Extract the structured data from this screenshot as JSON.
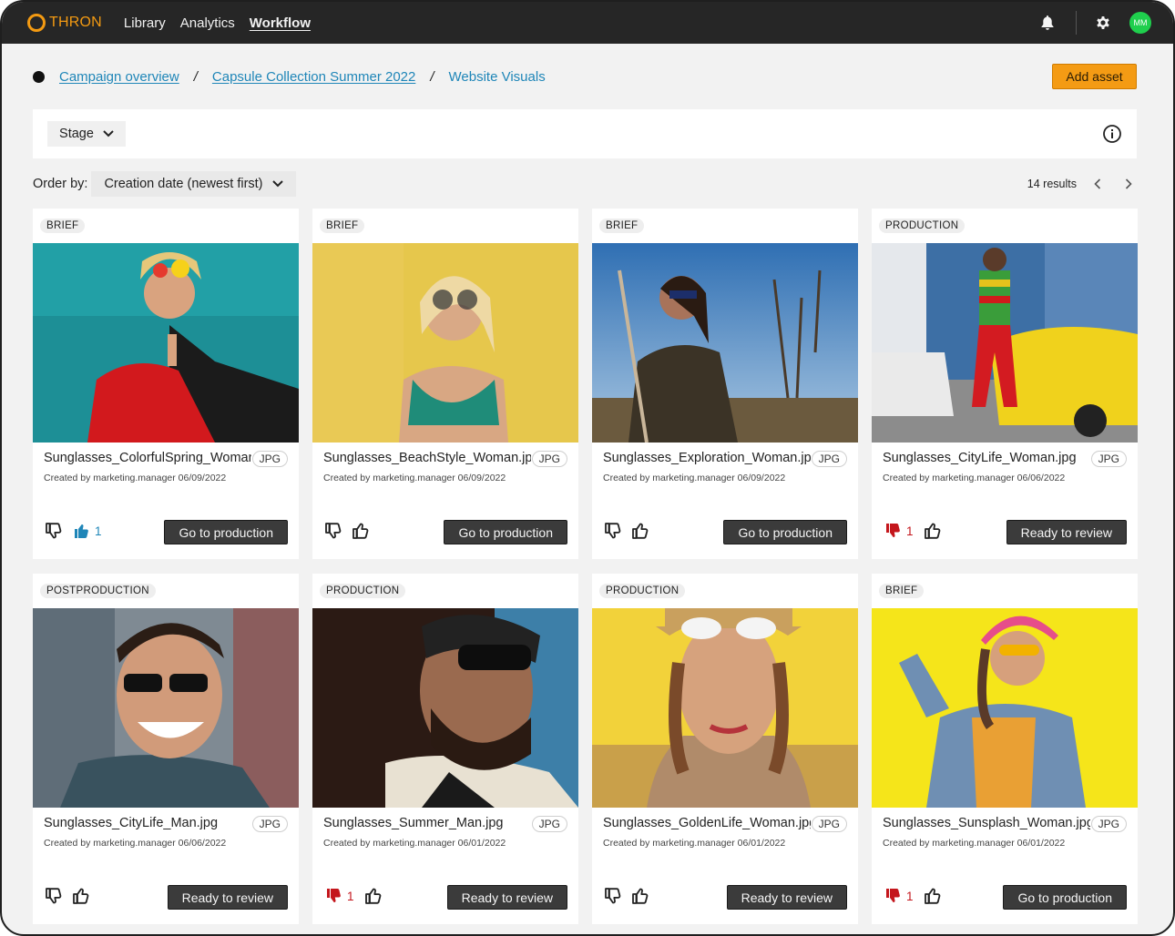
{
  "app": {
    "logo_text": "THRON",
    "brand_color": "#f39a12"
  },
  "nav": {
    "items": [
      "Library",
      "Analytics",
      "Workflow"
    ],
    "active": "Workflow"
  },
  "topbar": {
    "avatar_initials": "MM",
    "avatar_color": "#1fcf4d",
    "icons": [
      "bell-icon",
      "gear-icon"
    ]
  },
  "breadcrumb": {
    "items": [
      "Campaign overview",
      "Capsule Collection Summer 2022",
      "Website Visuals"
    ],
    "separator": "/"
  },
  "add_asset_label": "Add asset",
  "filter": {
    "stage_label": "Stage"
  },
  "order": {
    "label": "Order by:",
    "value": "Creation date (newest first)"
  },
  "results_text": "14 results",
  "cards": [
    {
      "stage": "BRIEF",
      "filename": "Sunglasses_ColorfulSpring_Woman.",
      "format": "JPG",
      "created": "Created by marketing.manager 06/09/2022",
      "dislikes": "",
      "likes": "1",
      "cta": "Go to production"
    },
    {
      "stage": "BRIEF",
      "filename": "Sunglasses_BeachStyle_Woman.jpg",
      "format": "JPG",
      "created": "Created by marketing.manager 06/09/2022",
      "dislikes": "",
      "likes": "",
      "cta": "Go to production"
    },
    {
      "stage": "BRIEF",
      "filename": "Sunglasses_Exploration_Woman.jpg",
      "format": "JPG",
      "created": "Created by marketing.manager 06/09/2022",
      "dislikes": "",
      "likes": "",
      "cta": "Go to production"
    },
    {
      "stage": "PRODUCTION",
      "filename": "Sunglasses_CityLife_Woman.jpg",
      "format": "JPG",
      "created": "Created by marketing.manager 06/06/2022",
      "dislikes": "1",
      "likes": "",
      "cta": "Ready to review"
    },
    {
      "stage": "POSTPRODUCTION",
      "filename": "Sunglasses_CityLife_Man.jpg",
      "format": "JPG",
      "created": "Created by marketing.manager 06/06/2022",
      "dislikes": "",
      "likes": "",
      "cta": "Ready to review"
    },
    {
      "stage": "PRODUCTION",
      "filename": "Sunglasses_Summer_Man.jpg",
      "format": "JPG",
      "created": "Created by marketing.manager 06/01/2022",
      "dislikes": "1",
      "likes": "",
      "cta": "Ready to review"
    },
    {
      "stage": "PRODUCTION",
      "filename": "Sunglasses_GoldenLife_Woman.jpg",
      "format": "JPG",
      "created": "Created by marketing.manager 06/01/2022",
      "dislikes": "",
      "likes": "",
      "cta": "Ready to review"
    },
    {
      "stage": "BRIEF",
      "filename": "Sunglasses_Sunsplash_Woman.jpg",
      "format": "JPG",
      "created": "Created by marketing.manager 06/01/2022",
      "dislikes": "1",
      "likes": "",
      "cta": "Go to production"
    }
  ],
  "colors": {
    "topbar": "#262626",
    "accent": "#f49b14",
    "link": "#1f86b8",
    "dislike_active": "#c4161c",
    "like_active": "#1f86b8",
    "cta": "#3b3b3b"
  }
}
